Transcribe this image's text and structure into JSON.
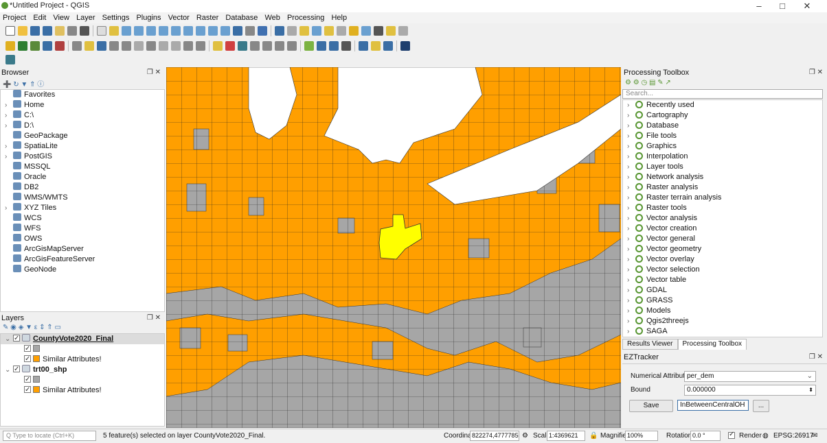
{
  "window": {
    "title": "*Untitled Project - QGIS",
    "minimize": "–",
    "maximize": "□",
    "close": "✕"
  },
  "menu": [
    "Project",
    "Edit",
    "View",
    "Layer",
    "Settings",
    "Plugins",
    "Vector",
    "Raster",
    "Database",
    "Web",
    "Processing",
    "Help"
  ],
  "browser": {
    "title": "Browser",
    "items": [
      {
        "label": "Favorites",
        "icon": "star-icon",
        "expand": false
      },
      {
        "label": "Home",
        "icon": "home-folder-icon",
        "expand": true
      },
      {
        "label": "C:\\",
        "icon": "drive-icon",
        "expand": true
      },
      {
        "label": "D:\\",
        "icon": "drive-icon",
        "expand": true
      },
      {
        "label": "GeoPackage",
        "icon": "geopackage-icon",
        "expand": false
      },
      {
        "label": "SpatiaLite",
        "icon": "spatialite-icon",
        "expand": true
      },
      {
        "label": "PostGIS",
        "icon": "postgis-icon",
        "expand": true
      },
      {
        "label": "MSSQL",
        "icon": "mssql-icon",
        "expand": false
      },
      {
        "label": "Oracle",
        "icon": "oracle-icon",
        "expand": false
      },
      {
        "label": "DB2",
        "icon": "db2-icon",
        "expand": false
      },
      {
        "label": "WMS/WMTS",
        "icon": "wms-icon",
        "expand": false
      },
      {
        "label": "XYZ Tiles",
        "icon": "xyz-icon",
        "expand": true
      },
      {
        "label": "WCS",
        "icon": "wcs-icon",
        "expand": false
      },
      {
        "label": "WFS",
        "icon": "wfs-icon",
        "expand": false
      },
      {
        "label": "OWS",
        "icon": "ows-icon",
        "expand": false
      },
      {
        "label": "ArcGisMapServer",
        "icon": "arcgis-map-icon",
        "expand": false
      },
      {
        "label": "ArcGisFeatureServer",
        "icon": "arcgis-feature-icon",
        "expand": false
      },
      {
        "label": "GeoNode",
        "icon": "geonode-icon",
        "expand": false
      }
    ]
  },
  "layers": {
    "title": "Layers",
    "items": [
      {
        "name": "CountyVote2020_Final",
        "sub": "Similar Attributes!",
        "active": true
      },
      {
        "name": "trt00_shp",
        "sub": "Similar Attributes!",
        "active": false
      }
    ]
  },
  "toolbox": {
    "title": "Processing Toolbox",
    "search_placeholder": "Search...",
    "items": [
      "Recently used",
      "Cartography",
      "Database",
      "File tools",
      "Graphics",
      "Interpolation",
      "Layer tools",
      "Network analysis",
      "Raster analysis",
      "Raster terrain analysis",
      "Raster tools",
      "Vector analysis",
      "Vector creation",
      "Vector general",
      "Vector geometry",
      "Vector overlay",
      "Vector selection",
      "Vector table",
      "GDAL",
      "GRASS",
      "Models",
      "Qgis2threejs",
      "SAGA"
    ],
    "tabs": [
      "Results Viewer",
      "Processing Toolbox"
    ]
  },
  "ez": {
    "title": "EZTracker",
    "num_label": "Numerical Attributes",
    "num_value": "per_dem",
    "bound_label": "Bound",
    "bound_value": "0.000000",
    "save": "Save",
    "output": "InBetweenCentralOH",
    "browse": "..."
  },
  "status": {
    "locate_placeholder": "Q  Type to locate (Ctrl+K)",
    "message": "5 feature(s) selected on layer CountyVote2020_Final.",
    "coord_label": "Coordinate",
    "coord": "822274,4777785",
    "scale_label": "Scale",
    "scale": "1:4369621",
    "magnifier_label": "Magnifier",
    "magnifier": "100%",
    "rotation_label": "Rotation",
    "rotation": "0.0 °",
    "render": "Render",
    "crs": "EPSG:26917"
  },
  "colors": {
    "fill_default": "#ff9f00",
    "fill_nodata": "#a6a6a6",
    "fill_selected": "#ffff00",
    "lake": "#ffffff",
    "accent": "#589632"
  }
}
